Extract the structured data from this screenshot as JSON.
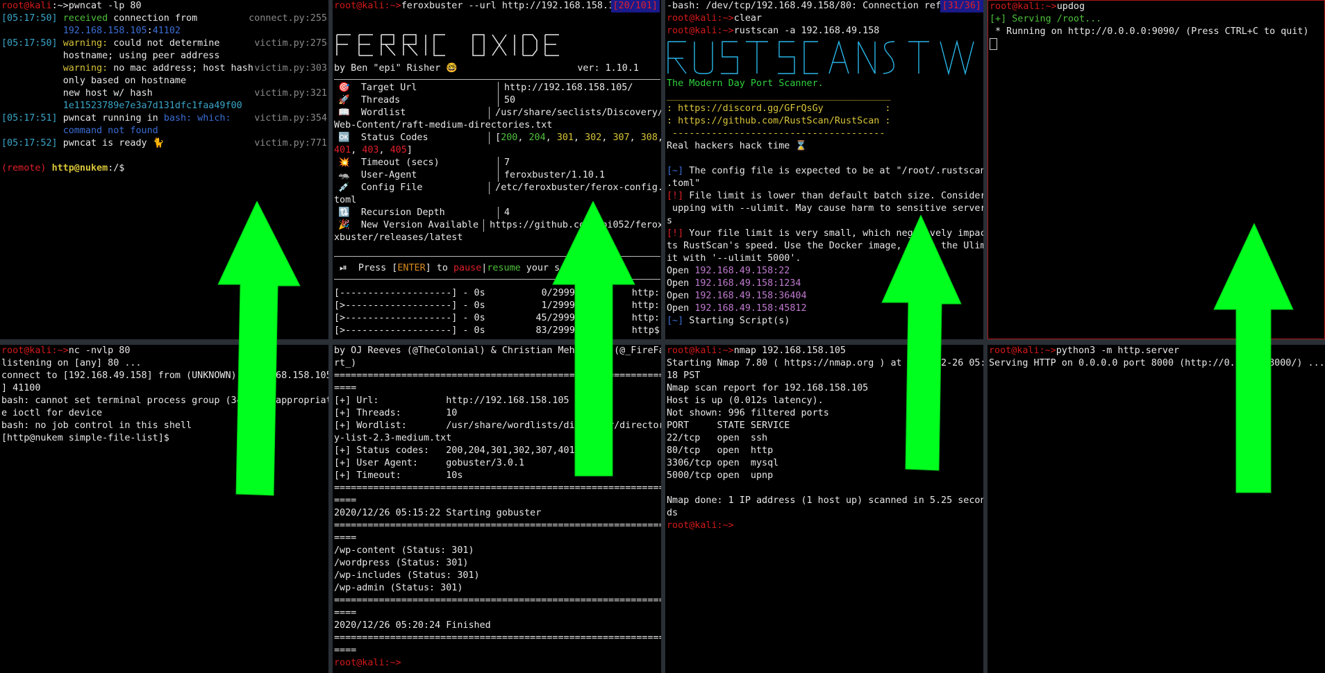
{
  "panes": {
    "pwncat": {
      "prompt_user": "root@kali",
      "prompt_sep": ":~>",
      "command": "pwncat -lp 80",
      "log": [
        {
          "time": "[05:17:50]",
          "msg": "received connection from",
          "file": "connect.py:255"
        },
        {
          "time": "",
          "msg": "192.168.158.105:41102",
          "file": ""
        },
        {
          "time": "[05:17:50]",
          "msg": "warning: could not determine",
          "file": "victim.py:275"
        },
        {
          "time": "",
          "msg": "hostname; using peer address",
          "file": ""
        },
        {
          "time": "",
          "msg": "warning: no mac address; host hash",
          "file": "victim.py:303"
        },
        {
          "time": "",
          "msg": "only based on hostname",
          "file": ""
        },
        {
          "time": "",
          "msg": "new host w/ hash",
          "file": "victim.py:321"
        },
        {
          "time": "",
          "msg": "1e11523789e7e3a7d131dfc1faa49f00",
          "file": ""
        },
        {
          "time": "[05:17:51]",
          "msg": "pwncat running in bash: which:",
          "file": "victim.py:354"
        },
        {
          "time": "",
          "msg": "command not found",
          "file": ""
        },
        {
          "time": "[05:17:52]",
          "msg": "pwncat is ready 🐈",
          "file": "victim.py:771"
        }
      ],
      "remote_prompt_tag": "(remote)",
      "remote_prompt_user": "http@nukem",
      "remote_prompt_path": ":/$"
    },
    "ferox": {
      "prompt": "root@kali:~>",
      "command": "feroxbuster --url http://192.168.158.10",
      "badge": "[20/101]",
      "author": "by Ben \"epi\" Risher 🤓",
      "version": "ver: 1.10.1",
      "rows": [
        {
          "icon": "🎯",
          "label": "Target Url",
          "value": "http://192.168.158.105/"
        },
        {
          "icon": "🚀",
          "label": "Threads",
          "value": "50"
        },
        {
          "icon": "📖",
          "label": "Wordlist",
          "value": "/usr/share/seclists/Discovery/"
        },
        {
          "icon": "",
          "label": "",
          "value": "Web-Content/raft-medium-directories.txt",
          "wrap": true
        },
        {
          "icon": "🆗",
          "label": "Status Codes",
          "value": "[200, 204, 301, 302, 307, 308,"
        },
        {
          "icon": "",
          "label": "",
          "value": "401, 403, 405]",
          "wrap": true
        },
        {
          "icon": "💥",
          "label": "Timeout (secs)",
          "value": "7"
        },
        {
          "icon": "🦡",
          "label": "User-Agent",
          "value": "feroxbuster/1.10.1"
        },
        {
          "icon": "💉",
          "label": "Config File",
          "value": "/etc/feroxbuster/ferox-config."
        },
        {
          "icon": "",
          "label": "",
          "value": "toml",
          "wrap": true
        },
        {
          "icon": "🔃",
          "label": "Recursion Depth",
          "value": "4"
        },
        {
          "icon": "🎉",
          "label": "New Version Available",
          "value": "https://github.com/epi052/ferox"
        },
        {
          "icon": "",
          "label": "",
          "value": "xbuster/releases/latest",
          "wrap": true
        }
      ],
      "pause_line": {
        "pre": "Press [",
        "key": "ENTER",
        "mid": "] to ",
        "pause": "pause",
        "resume": "resume",
        "post": " your scan"
      },
      "progress": [
        {
          "bar": "[--------------------] - 0s",
          "count": "0/29999",
          "url": "http:"
        },
        {
          "bar": "[>-------------------] - 0s",
          "count": "1/29999",
          "url": "http:"
        },
        {
          "bar": "[>-------------------] - 0s",
          "count": "45/29999",
          "url": "http:"
        },
        {
          "bar": "[>-------------------] - 0s",
          "count": "83/29999",
          "url": "http$"
        }
      ]
    },
    "rustscan": {
      "line1": "-bash: /dev/tcp/192.168.49.158/80: Connection refu",
      "badge": "[31/36]",
      "prompt": "root@kali:~>",
      "cmd1": "clear",
      "cmd2": "rustscan -a 192.168.49.158",
      "tagline": "The Modern Day Port Scanner.",
      "divider": "________________________________________",
      "link1": ": https://discord.gg/GFrQsGy           :",
      "link2": ": https://github.com/RustScan/RustScan :",
      "divider2": " --------------------------------------",
      "hack_time": "Real hackers hack time ⌛",
      "info1_tag": "[~]",
      "info1": " The config file is expected to be at \"/root/.rustscan",
      "info1b": ".toml\"",
      "warn1_tag": "[!]",
      "warn1": " File limit is lower than default batch size. Consider",
      "warn1b": " upping with --ulimit. May cause harm to sensitive server",
      "warn1c": "s",
      "warn2_tag": "[!]",
      "warn2": " Your file limit is very small, which negatively impac",
      "warn2b": "ts RustScan's speed. Use the Docker image, or up the Ulim",
      "warn2c": "it with '--ulimit 5000'.",
      "open": [
        "192.168.49.158:22",
        "192.168.49.158:1234",
        "192.168.49.158:36404",
        "192.168.49.158:45812"
      ],
      "open_label": "Open",
      "starting_tag": "[~]",
      "starting": " Starting Script(s)"
    },
    "updog": {
      "prompt": "root@kali:~>",
      "command": "updog",
      "serving": "[+] Serving /root...",
      "running": " * Running on http://0.0.0.0:9090/ (Press CTRL+C to quit)"
    },
    "nc": {
      "prompt": "root@kali:~>",
      "command": "nc -nvlp 80",
      "lines": [
        "listening on [any] 80 ...",
        "connect to [192.168.49.158] from (UNKNOWN) [192.168.158.105",
        "] 41100",
        "bash: cannot set terminal process group (344): Inappropriat",
        "e ioctl for device",
        "bash: no job control in this shell",
        "[http@nukem simple-file-list]$"
      ]
    },
    "gobuster": {
      "lines": [
        "by OJ Reeves (@TheColonial) & Christian Mehlmauer (@_FireFa",
        "rt_)",
        "===============================================================",
        "====",
        "[+] Url:            http://192.168.158.105",
        "[+] Threads:        10",
        "[+] Wordlist:       /usr/share/wordlists/dirbuster/director",
        "y-list-2.3-medium.txt",
        "[+] Status codes:   200,204,301,302,307,401,403",
        "[+] User Agent:     gobuster/3.0.1",
        "[+] Timeout:        10s",
        "===============================================================",
        "====",
        "2020/12/26 05:15:22 Starting gobuster",
        "===============================================================",
        "====",
        "/wp-content (Status: 301)",
        "/wordpress (Status: 301)",
        "/wp-includes (Status: 301)",
        "/wp-admin (Status: 301)",
        "===============================================================",
        "====",
        "2020/12/26 05:20:24 Finished",
        "===============================================================",
        "===="
      ],
      "prompt": "root@kali:~>"
    },
    "nmap": {
      "prompt": "root@kali:~>",
      "command": "nmap 192.168.158.105",
      "lines": [
        "Starting Nmap 7.80 ( https://nmap.org ) at 2020-12-26 05:",
        "18 PST",
        "Nmap scan report for 192.168.158.105",
        "Host is up (0.012s latency).",
        "Not shown: 996 filtered ports",
        "PORT     STATE SERVICE",
        "22/tcp   open  ssh",
        "80/tcp   open  http",
        "3306/tcp open  mysql",
        "5000/tcp open  upnp",
        "",
        "Nmap done: 1 IP address (1 host up) scanned in 5.25 secon",
        "ds"
      ],
      "prompt_end": "root@kali:~>"
    },
    "httpserver": {
      "prompt": "root@kali:~>",
      "command": "python3 -m http.server",
      "line": "Serving HTTP on 0.0.0.0 port 8000 (http://0.0.0.0:8000/) ..."
    }
  },
  "colors": {
    "arrow": "#00ff1e",
    "root_prompt": "#d61a1a",
    "separator": "#2a2f36"
  }
}
